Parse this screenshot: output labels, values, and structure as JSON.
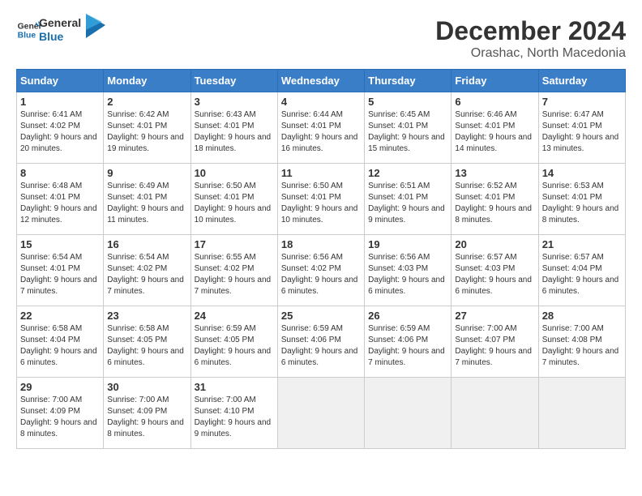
{
  "header": {
    "logo_line1": "General",
    "logo_line2": "Blue",
    "month": "December 2024",
    "location": "Orashac, North Macedonia"
  },
  "weekdays": [
    "Sunday",
    "Monday",
    "Tuesday",
    "Wednesday",
    "Thursday",
    "Friday",
    "Saturday"
  ],
  "weeks": [
    [
      {
        "day": 1,
        "sunrise": "6:41 AM",
        "sunset": "4:02 PM",
        "daylight": "9 hours and 20 minutes."
      },
      {
        "day": 2,
        "sunrise": "6:42 AM",
        "sunset": "4:01 PM",
        "daylight": "9 hours and 19 minutes."
      },
      {
        "day": 3,
        "sunrise": "6:43 AM",
        "sunset": "4:01 PM",
        "daylight": "9 hours and 18 minutes."
      },
      {
        "day": 4,
        "sunrise": "6:44 AM",
        "sunset": "4:01 PM",
        "daylight": "9 hours and 16 minutes."
      },
      {
        "day": 5,
        "sunrise": "6:45 AM",
        "sunset": "4:01 PM",
        "daylight": "9 hours and 15 minutes."
      },
      {
        "day": 6,
        "sunrise": "6:46 AM",
        "sunset": "4:01 PM",
        "daylight": "9 hours and 14 minutes."
      },
      {
        "day": 7,
        "sunrise": "6:47 AM",
        "sunset": "4:01 PM",
        "daylight": "9 hours and 13 minutes."
      }
    ],
    [
      {
        "day": 8,
        "sunrise": "6:48 AM",
        "sunset": "4:01 PM",
        "daylight": "9 hours and 12 minutes."
      },
      {
        "day": 9,
        "sunrise": "6:49 AM",
        "sunset": "4:01 PM",
        "daylight": "9 hours and 11 minutes."
      },
      {
        "day": 10,
        "sunrise": "6:50 AM",
        "sunset": "4:01 PM",
        "daylight": "9 hours and 10 minutes."
      },
      {
        "day": 11,
        "sunrise": "6:50 AM",
        "sunset": "4:01 PM",
        "daylight": "9 hours and 10 minutes."
      },
      {
        "day": 12,
        "sunrise": "6:51 AM",
        "sunset": "4:01 PM",
        "daylight": "9 hours and 9 minutes."
      },
      {
        "day": 13,
        "sunrise": "6:52 AM",
        "sunset": "4:01 PM",
        "daylight": "9 hours and 8 minutes."
      },
      {
        "day": 14,
        "sunrise": "6:53 AM",
        "sunset": "4:01 PM",
        "daylight": "9 hours and 8 minutes."
      }
    ],
    [
      {
        "day": 15,
        "sunrise": "6:54 AM",
        "sunset": "4:01 PM",
        "daylight": "9 hours and 7 minutes."
      },
      {
        "day": 16,
        "sunrise": "6:54 AM",
        "sunset": "4:02 PM",
        "daylight": "9 hours and 7 minutes."
      },
      {
        "day": 17,
        "sunrise": "6:55 AM",
        "sunset": "4:02 PM",
        "daylight": "9 hours and 7 minutes."
      },
      {
        "day": 18,
        "sunrise": "6:56 AM",
        "sunset": "4:02 PM",
        "daylight": "9 hours and 6 minutes."
      },
      {
        "day": 19,
        "sunrise": "6:56 AM",
        "sunset": "4:03 PM",
        "daylight": "9 hours and 6 minutes."
      },
      {
        "day": 20,
        "sunrise": "6:57 AM",
        "sunset": "4:03 PM",
        "daylight": "9 hours and 6 minutes."
      },
      {
        "day": 21,
        "sunrise": "6:57 AM",
        "sunset": "4:04 PM",
        "daylight": "9 hours and 6 minutes."
      }
    ],
    [
      {
        "day": 22,
        "sunrise": "6:58 AM",
        "sunset": "4:04 PM",
        "daylight": "9 hours and 6 minutes."
      },
      {
        "day": 23,
        "sunrise": "6:58 AM",
        "sunset": "4:05 PM",
        "daylight": "9 hours and 6 minutes."
      },
      {
        "day": 24,
        "sunrise": "6:59 AM",
        "sunset": "4:05 PM",
        "daylight": "9 hours and 6 minutes."
      },
      {
        "day": 25,
        "sunrise": "6:59 AM",
        "sunset": "4:06 PM",
        "daylight": "9 hours and 6 minutes."
      },
      {
        "day": 26,
        "sunrise": "6:59 AM",
        "sunset": "4:06 PM",
        "daylight": "9 hours and 7 minutes."
      },
      {
        "day": 27,
        "sunrise": "7:00 AM",
        "sunset": "4:07 PM",
        "daylight": "9 hours and 7 minutes."
      },
      {
        "day": 28,
        "sunrise": "7:00 AM",
        "sunset": "4:08 PM",
        "daylight": "9 hours and 7 minutes."
      }
    ],
    [
      {
        "day": 29,
        "sunrise": "7:00 AM",
        "sunset": "4:09 PM",
        "daylight": "9 hours and 8 minutes."
      },
      {
        "day": 30,
        "sunrise": "7:00 AM",
        "sunset": "4:09 PM",
        "daylight": "9 hours and 8 minutes."
      },
      {
        "day": 31,
        "sunrise": "7:00 AM",
        "sunset": "4:10 PM",
        "daylight": "9 hours and 9 minutes."
      },
      null,
      null,
      null,
      null
    ]
  ]
}
